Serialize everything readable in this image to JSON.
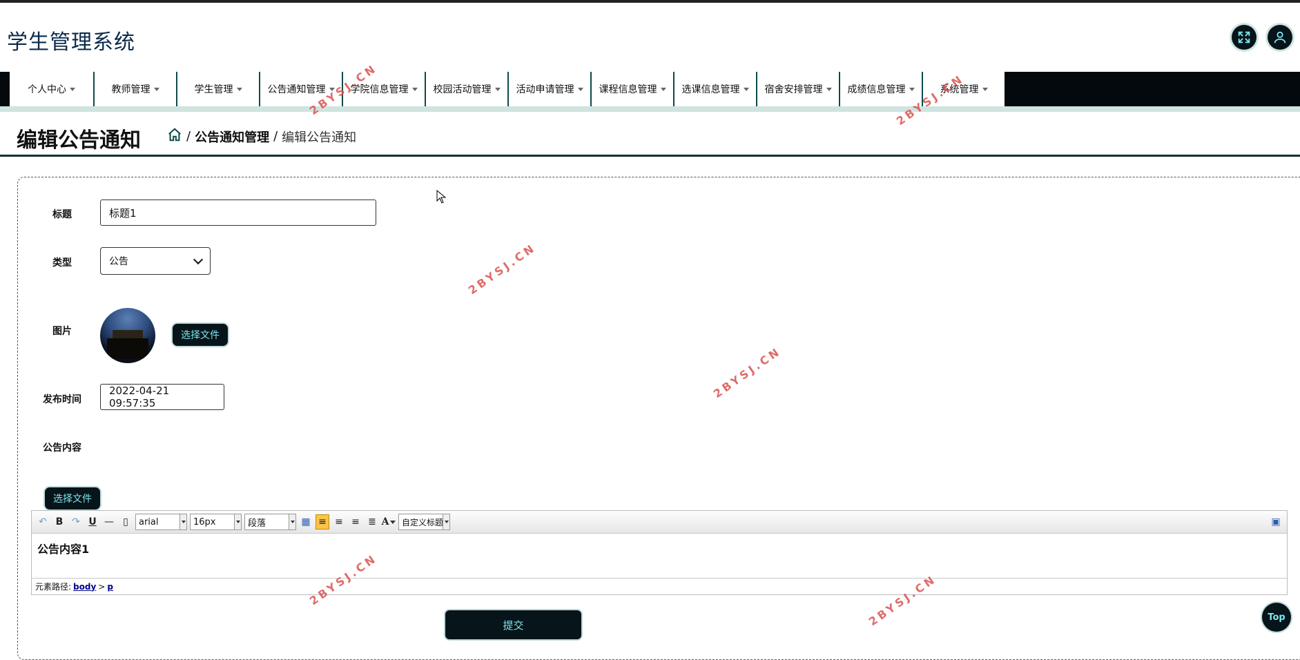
{
  "header": {
    "app_title": "学生管理系统"
  },
  "nav": {
    "items": [
      {
        "label": "个人中心"
      },
      {
        "label": "教师管理"
      },
      {
        "label": "学生管理"
      },
      {
        "label": "公告通知管理"
      },
      {
        "label": "学院信息管理"
      },
      {
        "label": "校园活动管理"
      },
      {
        "label": "活动申请管理"
      },
      {
        "label": "课程信息管理"
      },
      {
        "label": "选课信息管理"
      },
      {
        "label": "宿舍安排管理"
      },
      {
        "label": "成绩信息管理"
      },
      {
        "label": "系统管理"
      }
    ]
  },
  "page": {
    "title": "编辑公告通知",
    "breadcrumb": {
      "sep": "/",
      "parent": "公告通知管理",
      "current": "编辑公告通知"
    }
  },
  "form": {
    "title_label": "标题",
    "title_value": "标题1",
    "type_label": "类型",
    "type_value": "公告",
    "image_label": "图片",
    "image_button": "选择文件",
    "time_label": "发布时间",
    "time_value": "2022-04-21 09:57:35",
    "content_label": "公告内容",
    "content_file_button": "选择文件",
    "submit_label": "提交"
  },
  "editor": {
    "font_family": "arial",
    "font_size": "16px",
    "paragraph": "段落",
    "custom_heading": "自定义标题",
    "font_color_glyph": "A",
    "content": "公告内容1",
    "path_label": "元素路径:",
    "path_body": "body",
    "path_sep": ">",
    "path_p": "p"
  },
  "top_button": "Top",
  "watermark": "2BYSJ.CN"
}
